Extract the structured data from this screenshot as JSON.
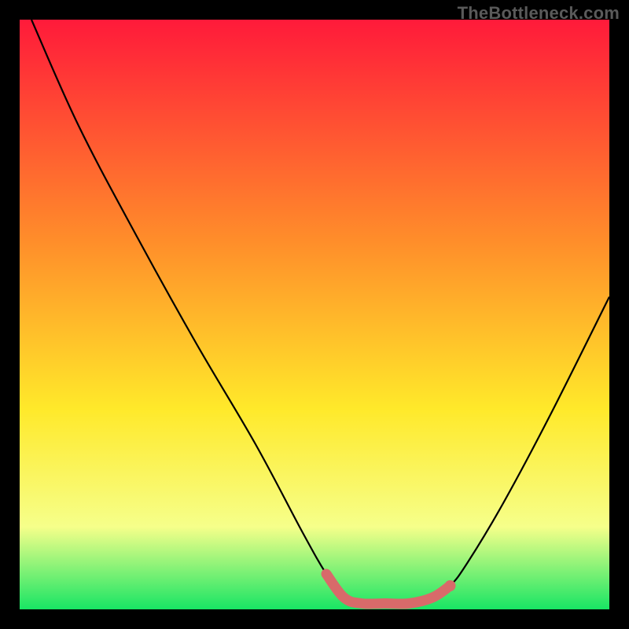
{
  "watermark": "TheBottleneck.com",
  "colors": {
    "gradient_top": "#ff1a3a",
    "gradient_upper_mid": "#ff8f2a",
    "gradient_mid": "#ffe92a",
    "gradient_lower_mid": "#f6ff8a",
    "gradient_bottom": "#18e564",
    "curve": "#000000",
    "highlight": "#d86a6a",
    "frame": "#000000"
  },
  "chart_data": {
    "type": "line",
    "title": "",
    "xlabel": "",
    "ylabel": "",
    "xlim": [
      0,
      100
    ],
    "ylim": [
      0,
      100
    ],
    "note": "Bottleneck-style curve on a rainbow vertical gradient. Axes are unlabeled; values are relative percentages of the plot area (0 = left/bottom, 100 = right/top). Y ≈ bottleneck severity (0 = good/green, 100 = bad/red). Valley floor around x 55–70.",
    "series": [
      {
        "name": "curve",
        "x": [
          2,
          10,
          20,
          30,
          40,
          48,
          52,
          55,
          58,
          62,
          66,
          70,
          73,
          76,
          82,
          90,
          100
        ],
        "y": [
          100,
          82,
          63,
          45,
          28,
          13,
          6,
          2,
          1,
          1,
          1,
          2,
          4,
          8,
          18,
          33,
          53
        ]
      },
      {
        "name": "highlight-valley",
        "x": [
          52,
          55,
          58,
          62,
          66,
          70,
          73
        ],
        "y": [
          6,
          2,
          1,
          1,
          1,
          2,
          4
        ]
      }
    ],
    "markers": [
      {
        "name": "highlight-dot",
        "x": 73,
        "y": 4
      }
    ]
  }
}
